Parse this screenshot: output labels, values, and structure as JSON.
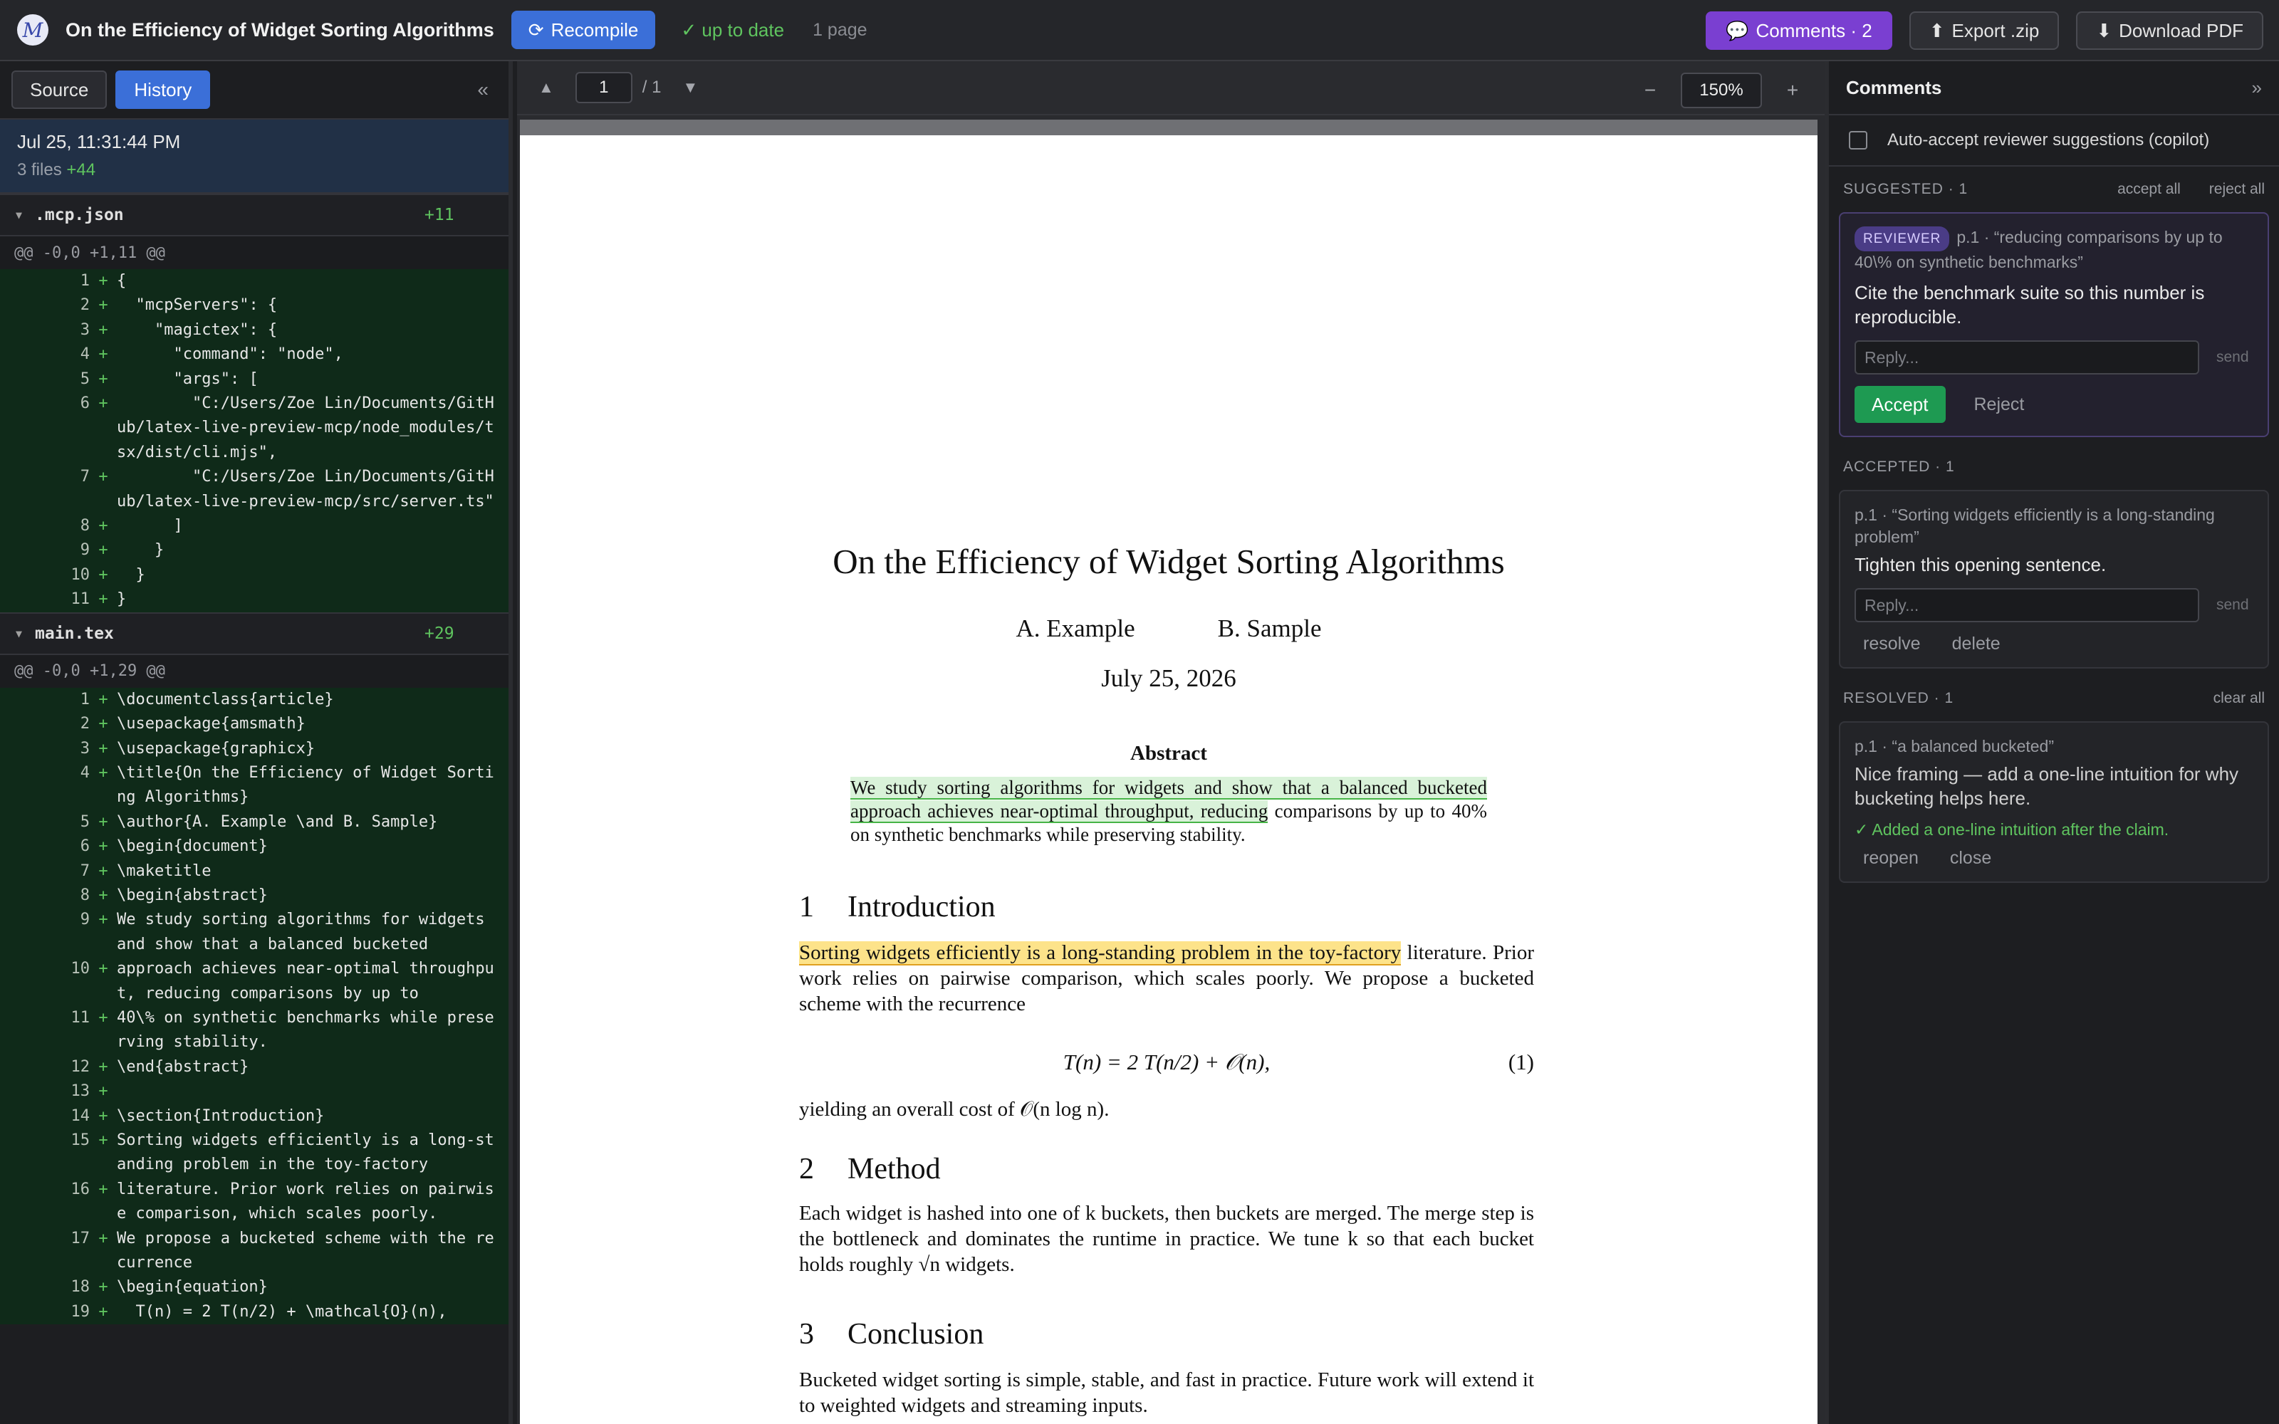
{
  "app": {
    "logo_glyph": "M",
    "title": "On the Efficiency of Widget Sorting Algorithms",
    "recompile_label": "Recompile",
    "status": "✓ up to date",
    "pages": "1 page",
    "comments_label": "Comments · 2",
    "export_label": "Export .zip",
    "download_label": "Download PDF"
  },
  "left": {
    "tabs": [
      "Source",
      "History"
    ],
    "active_tab": "History",
    "collapse": "«",
    "commit": {
      "date": "Jul 25, 11:31:44 PM",
      "files": "3 files",
      "additions": "+44"
    },
    "files": [
      {
        "name": ".mcp.json",
        "count": "+11",
        "hunk": "@@ -0,0 +1,11 @@",
        "lines": [
          {
            "n": "1",
            "code": "{"
          },
          {
            "n": "2",
            "code": "  \"mcpServers\": {"
          },
          {
            "n": "3",
            "code": "    \"magictex\": {"
          },
          {
            "n": "4",
            "code": "      \"command\": \"node\","
          },
          {
            "n": "5",
            "code": "      \"args\": ["
          },
          {
            "n": "6",
            "code": "        \"C:/Users/Zoe Lin/Documents/GitHub/latex-live-preview-mcp/node_modules/tsx/dist/cli.mjs\","
          },
          {
            "n": "7",
            "code": "        \"C:/Users/Zoe Lin/Documents/GitHub/latex-live-preview-mcp/src/server.ts\""
          },
          {
            "n": "8",
            "code": "      ]"
          },
          {
            "n": "9",
            "code": "    }"
          },
          {
            "n": "10",
            "code": "  }"
          },
          {
            "n": "11",
            "code": "}"
          }
        ]
      },
      {
        "name": "main.tex",
        "count": "+29",
        "hunk": "@@ -0,0 +1,29 @@",
        "lines": [
          {
            "n": "1",
            "code": "\\documentclass{article}"
          },
          {
            "n": "2",
            "code": "\\usepackage{amsmath}"
          },
          {
            "n": "3",
            "code": "\\usepackage{graphicx}"
          },
          {
            "n": "4",
            "code": "\\title{On the Efficiency of Widget Sorting Algorithms}"
          },
          {
            "n": "5",
            "code": "\\author{A. Example \\and B. Sample}"
          },
          {
            "n": "6",
            "code": "\\begin{document}"
          },
          {
            "n": "7",
            "code": "\\maketitle"
          },
          {
            "n": "8",
            "code": "\\begin{abstract}"
          },
          {
            "n": "9",
            "code": "We study sorting algorithms for widgets and show that a balanced bucketed"
          },
          {
            "n": "10",
            "code": "approach achieves near-optimal throughput, reducing comparisons by up to"
          },
          {
            "n": "11",
            "code": "40\\% on synthetic benchmarks while preserving stability."
          },
          {
            "n": "12",
            "code": "\\end{abstract}"
          },
          {
            "n": "13",
            "code": ""
          },
          {
            "n": "14",
            "code": "\\section{Introduction}"
          },
          {
            "n": "15",
            "code": "Sorting widgets efficiently is a long-standing problem in the toy-factory"
          },
          {
            "n": "16",
            "code": "literature. Prior work relies on pairwise comparison, which scales poorly."
          },
          {
            "n": "17",
            "code": "We propose a bucketed scheme with the recurrence"
          },
          {
            "n": "18",
            "code": "\\begin{equation}"
          },
          {
            "n": "19",
            "code": "  T(n) = 2 T(n/2) + \\mathcal{O}(n),"
          }
        ]
      }
    ]
  },
  "viewer": {
    "page_current": "1",
    "page_total": "/ 1",
    "zoom": "150%",
    "prev": "▲",
    "next": "▼",
    "zoom_out": "−",
    "zoom_in": "+"
  },
  "paper": {
    "title": "On the Efficiency of Widget Sorting Algorithms",
    "authors": [
      "A. Example",
      "B. Sample"
    ],
    "date": "July 25, 2026",
    "abstract_heading": "Abstract",
    "abstract_highlight": "We study sorting algorithms for widgets and show that a balanced bucketed approach achieves near-optimal throughput, reducing",
    "abstract_rest": " comparisons by up to 40% on synthetic benchmarks while preserving stability.",
    "sections": [
      {
        "num": "1",
        "title": "Introduction"
      },
      {
        "num": "2",
        "title": "Method"
      },
      {
        "num": "3",
        "title": "Conclusion"
      }
    ],
    "intro_highlight": "Sorting widgets efficiently is a long-standing problem in the toy-factory",
    "intro_rest": " literature. Prior work relies on pairwise comparison, which scales poorly. We propose a bucketed scheme with the recurrence",
    "equation": "T(n) = 2 T(n/2) + 𝒪(n),",
    "equation_number": "(1)",
    "after_equation": "yielding an overall cost of 𝒪(n log n).",
    "method_text": "Each widget is hashed into one of k buckets, then buckets are merged. The merge step is the bottleneck and dominates the runtime in practice. We tune k so that each bucket holds roughly √n widgets.",
    "conclusion_text": "Bucketed widget sorting is simple, stable, and fast in practice. Future work will extend it to weighted widgets and streaming inputs."
  },
  "comments": {
    "heading": "Comments",
    "collapse": "»",
    "auto_accept": "Auto-accept reviewer suggestions (copilot)",
    "suggested": {
      "label": "SUGGESTED · 1",
      "accept_all": "accept all",
      "reject_all": "reject all",
      "badge": "REVIEWER",
      "quote": "p.1 · “reducing comparisons by up to 40\\% on synthetic benchmarks”",
      "body": "Cite the benchmark suite so this number is reproducible.",
      "reply_placeholder": "Reply...",
      "send": "send",
      "accept": "Accept",
      "reject": "Reject"
    },
    "accepted": {
      "label": "ACCEPTED · 1",
      "quote": "p.1 · “Sorting widgets efficiently is a long-standing problem”",
      "body": "Tighten this opening sentence.",
      "reply_placeholder": "Reply...",
      "send": "send",
      "resolve": "resolve",
      "delete": "delete"
    },
    "resolved": {
      "label": "RESOLVED · 1",
      "clear_all": "clear all",
      "quote": "p.1 · “a balanced bucketed”",
      "body": "Nice framing — add a one-line intuition for why bucketing helps here.",
      "note": "✓ Added a one-line intuition after the claim.",
      "reopen": "reopen",
      "close": "close"
    }
  },
  "colors": {
    "accent_blue": "#3b6fd8",
    "comments_purple": "#7a3fd1",
    "success_green": "#5fc45f",
    "accept_green": "#1e9a52",
    "diff_bg": "#0f2a19",
    "highlight_green": "#d9f2d9",
    "highlight_yellow": "#fde38a"
  }
}
